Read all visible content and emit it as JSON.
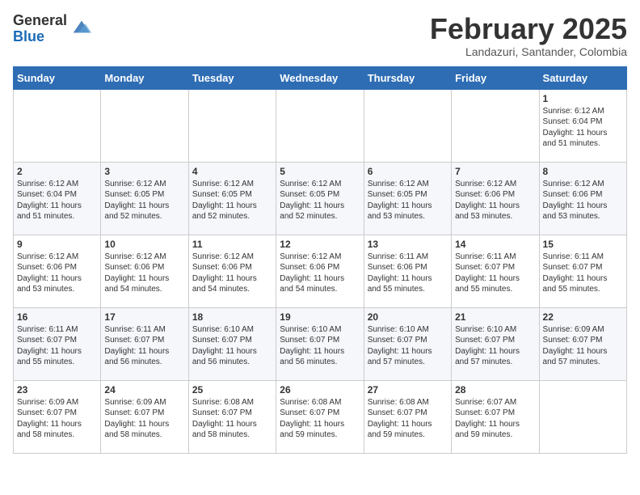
{
  "header": {
    "logo_general": "General",
    "logo_blue": "Blue",
    "month_year": "February 2025",
    "location": "Landazuri, Santander, Colombia"
  },
  "days_of_week": [
    "Sunday",
    "Monday",
    "Tuesday",
    "Wednesday",
    "Thursday",
    "Friday",
    "Saturday"
  ],
  "weeks": [
    [
      {
        "day": "",
        "info": ""
      },
      {
        "day": "",
        "info": ""
      },
      {
        "day": "",
        "info": ""
      },
      {
        "day": "",
        "info": ""
      },
      {
        "day": "",
        "info": ""
      },
      {
        "day": "",
        "info": ""
      },
      {
        "day": "1",
        "info": "Sunrise: 6:12 AM\nSunset: 6:04 PM\nDaylight: 11 hours\nand 51 minutes."
      }
    ],
    [
      {
        "day": "2",
        "info": "Sunrise: 6:12 AM\nSunset: 6:04 PM\nDaylight: 11 hours\nand 51 minutes."
      },
      {
        "day": "3",
        "info": "Sunrise: 6:12 AM\nSunset: 6:05 PM\nDaylight: 11 hours\nand 52 minutes."
      },
      {
        "day": "4",
        "info": "Sunrise: 6:12 AM\nSunset: 6:05 PM\nDaylight: 11 hours\nand 52 minutes."
      },
      {
        "day": "5",
        "info": "Sunrise: 6:12 AM\nSunset: 6:05 PM\nDaylight: 11 hours\nand 52 minutes."
      },
      {
        "day": "6",
        "info": "Sunrise: 6:12 AM\nSunset: 6:05 PM\nDaylight: 11 hours\nand 53 minutes."
      },
      {
        "day": "7",
        "info": "Sunrise: 6:12 AM\nSunset: 6:06 PM\nDaylight: 11 hours\nand 53 minutes."
      },
      {
        "day": "8",
        "info": "Sunrise: 6:12 AM\nSunset: 6:06 PM\nDaylight: 11 hours\nand 53 minutes."
      }
    ],
    [
      {
        "day": "9",
        "info": "Sunrise: 6:12 AM\nSunset: 6:06 PM\nDaylight: 11 hours\nand 53 minutes."
      },
      {
        "day": "10",
        "info": "Sunrise: 6:12 AM\nSunset: 6:06 PM\nDaylight: 11 hours\nand 54 minutes."
      },
      {
        "day": "11",
        "info": "Sunrise: 6:12 AM\nSunset: 6:06 PM\nDaylight: 11 hours\nand 54 minutes."
      },
      {
        "day": "12",
        "info": "Sunrise: 6:12 AM\nSunset: 6:06 PM\nDaylight: 11 hours\nand 54 minutes."
      },
      {
        "day": "13",
        "info": "Sunrise: 6:11 AM\nSunset: 6:06 PM\nDaylight: 11 hours\nand 55 minutes."
      },
      {
        "day": "14",
        "info": "Sunrise: 6:11 AM\nSunset: 6:07 PM\nDaylight: 11 hours\nand 55 minutes."
      },
      {
        "day": "15",
        "info": "Sunrise: 6:11 AM\nSunset: 6:07 PM\nDaylight: 11 hours\nand 55 minutes."
      }
    ],
    [
      {
        "day": "16",
        "info": "Sunrise: 6:11 AM\nSunset: 6:07 PM\nDaylight: 11 hours\nand 55 minutes."
      },
      {
        "day": "17",
        "info": "Sunrise: 6:11 AM\nSunset: 6:07 PM\nDaylight: 11 hours\nand 56 minutes."
      },
      {
        "day": "18",
        "info": "Sunrise: 6:10 AM\nSunset: 6:07 PM\nDaylight: 11 hours\nand 56 minutes."
      },
      {
        "day": "19",
        "info": "Sunrise: 6:10 AM\nSunset: 6:07 PM\nDaylight: 11 hours\nand 56 minutes."
      },
      {
        "day": "20",
        "info": "Sunrise: 6:10 AM\nSunset: 6:07 PM\nDaylight: 11 hours\nand 57 minutes."
      },
      {
        "day": "21",
        "info": "Sunrise: 6:10 AM\nSunset: 6:07 PM\nDaylight: 11 hours\nand 57 minutes."
      },
      {
        "day": "22",
        "info": "Sunrise: 6:09 AM\nSunset: 6:07 PM\nDaylight: 11 hours\nand 57 minutes."
      }
    ],
    [
      {
        "day": "23",
        "info": "Sunrise: 6:09 AM\nSunset: 6:07 PM\nDaylight: 11 hours\nand 58 minutes."
      },
      {
        "day": "24",
        "info": "Sunrise: 6:09 AM\nSunset: 6:07 PM\nDaylight: 11 hours\nand 58 minutes."
      },
      {
        "day": "25",
        "info": "Sunrise: 6:08 AM\nSunset: 6:07 PM\nDaylight: 11 hours\nand 58 minutes."
      },
      {
        "day": "26",
        "info": "Sunrise: 6:08 AM\nSunset: 6:07 PM\nDaylight: 11 hours\nand 59 minutes."
      },
      {
        "day": "27",
        "info": "Sunrise: 6:08 AM\nSunset: 6:07 PM\nDaylight: 11 hours\nand 59 minutes."
      },
      {
        "day": "28",
        "info": "Sunrise: 6:07 AM\nSunset: 6:07 PM\nDaylight: 11 hours\nand 59 minutes."
      },
      {
        "day": "",
        "info": ""
      }
    ]
  ]
}
